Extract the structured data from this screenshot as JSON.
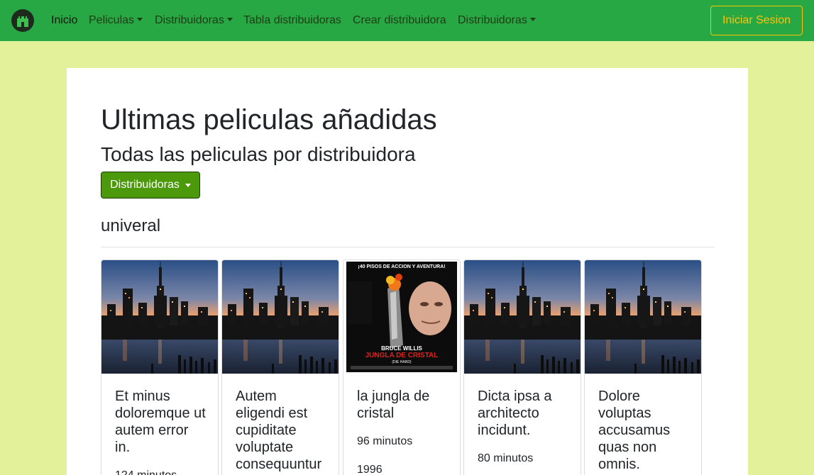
{
  "nav": {
    "items": [
      {
        "label": "Inicio",
        "dropdown": false,
        "active": true
      },
      {
        "label": "Peliculas",
        "dropdown": true,
        "active": false
      },
      {
        "label": "Distribuidoras",
        "dropdown": true,
        "active": false
      },
      {
        "label": "Tabla distribuidoras",
        "dropdown": false,
        "active": false
      },
      {
        "label": "Crear distribuidora",
        "dropdown": false,
        "active": false
      },
      {
        "label": "Distribuidoras",
        "dropdown": true,
        "active": false
      }
    ],
    "login_label": "Iniciar Sesion",
    "colors": {
      "navbar": "#28a745",
      "login": "#ffc107",
      "page_bg": "#e3f29a"
    }
  },
  "main": {
    "title": "Ultimas peliculas añadidas",
    "subtitle": "Todas las peliculas por distribuidora",
    "dropdown_label": "Distribuidoras",
    "section_title": "univeral",
    "movies": [
      {
        "title": "Et minus doloremque ut autem error in.",
        "duration": "124 minutos",
        "year": "",
        "image": "city-skyline"
      },
      {
        "title": "Autem eligendi est cupiditate voluptate consequuntur",
        "duration": "",
        "year": "",
        "image": "city-skyline"
      },
      {
        "title": "la jungla de cristal",
        "duration": "96 minutos",
        "year": "1996",
        "image": "poster"
      },
      {
        "title": "Dicta ipsa a architecto incidunt.",
        "duration": "80 minutos",
        "year": "",
        "image": "city-skyline"
      },
      {
        "title": "Dolore voluptas accusamus quas non omnis.",
        "duration": "",
        "year": "",
        "image": "city-skyline"
      }
    ]
  },
  "poster": {
    "tagline": "¡40 PISOS DE ACCION Y AVENTURA!",
    "actor": "BRUCE WILLIS",
    "film": "JUNGLA DE CRISTAL",
    "original": "(DIE HARD)"
  }
}
